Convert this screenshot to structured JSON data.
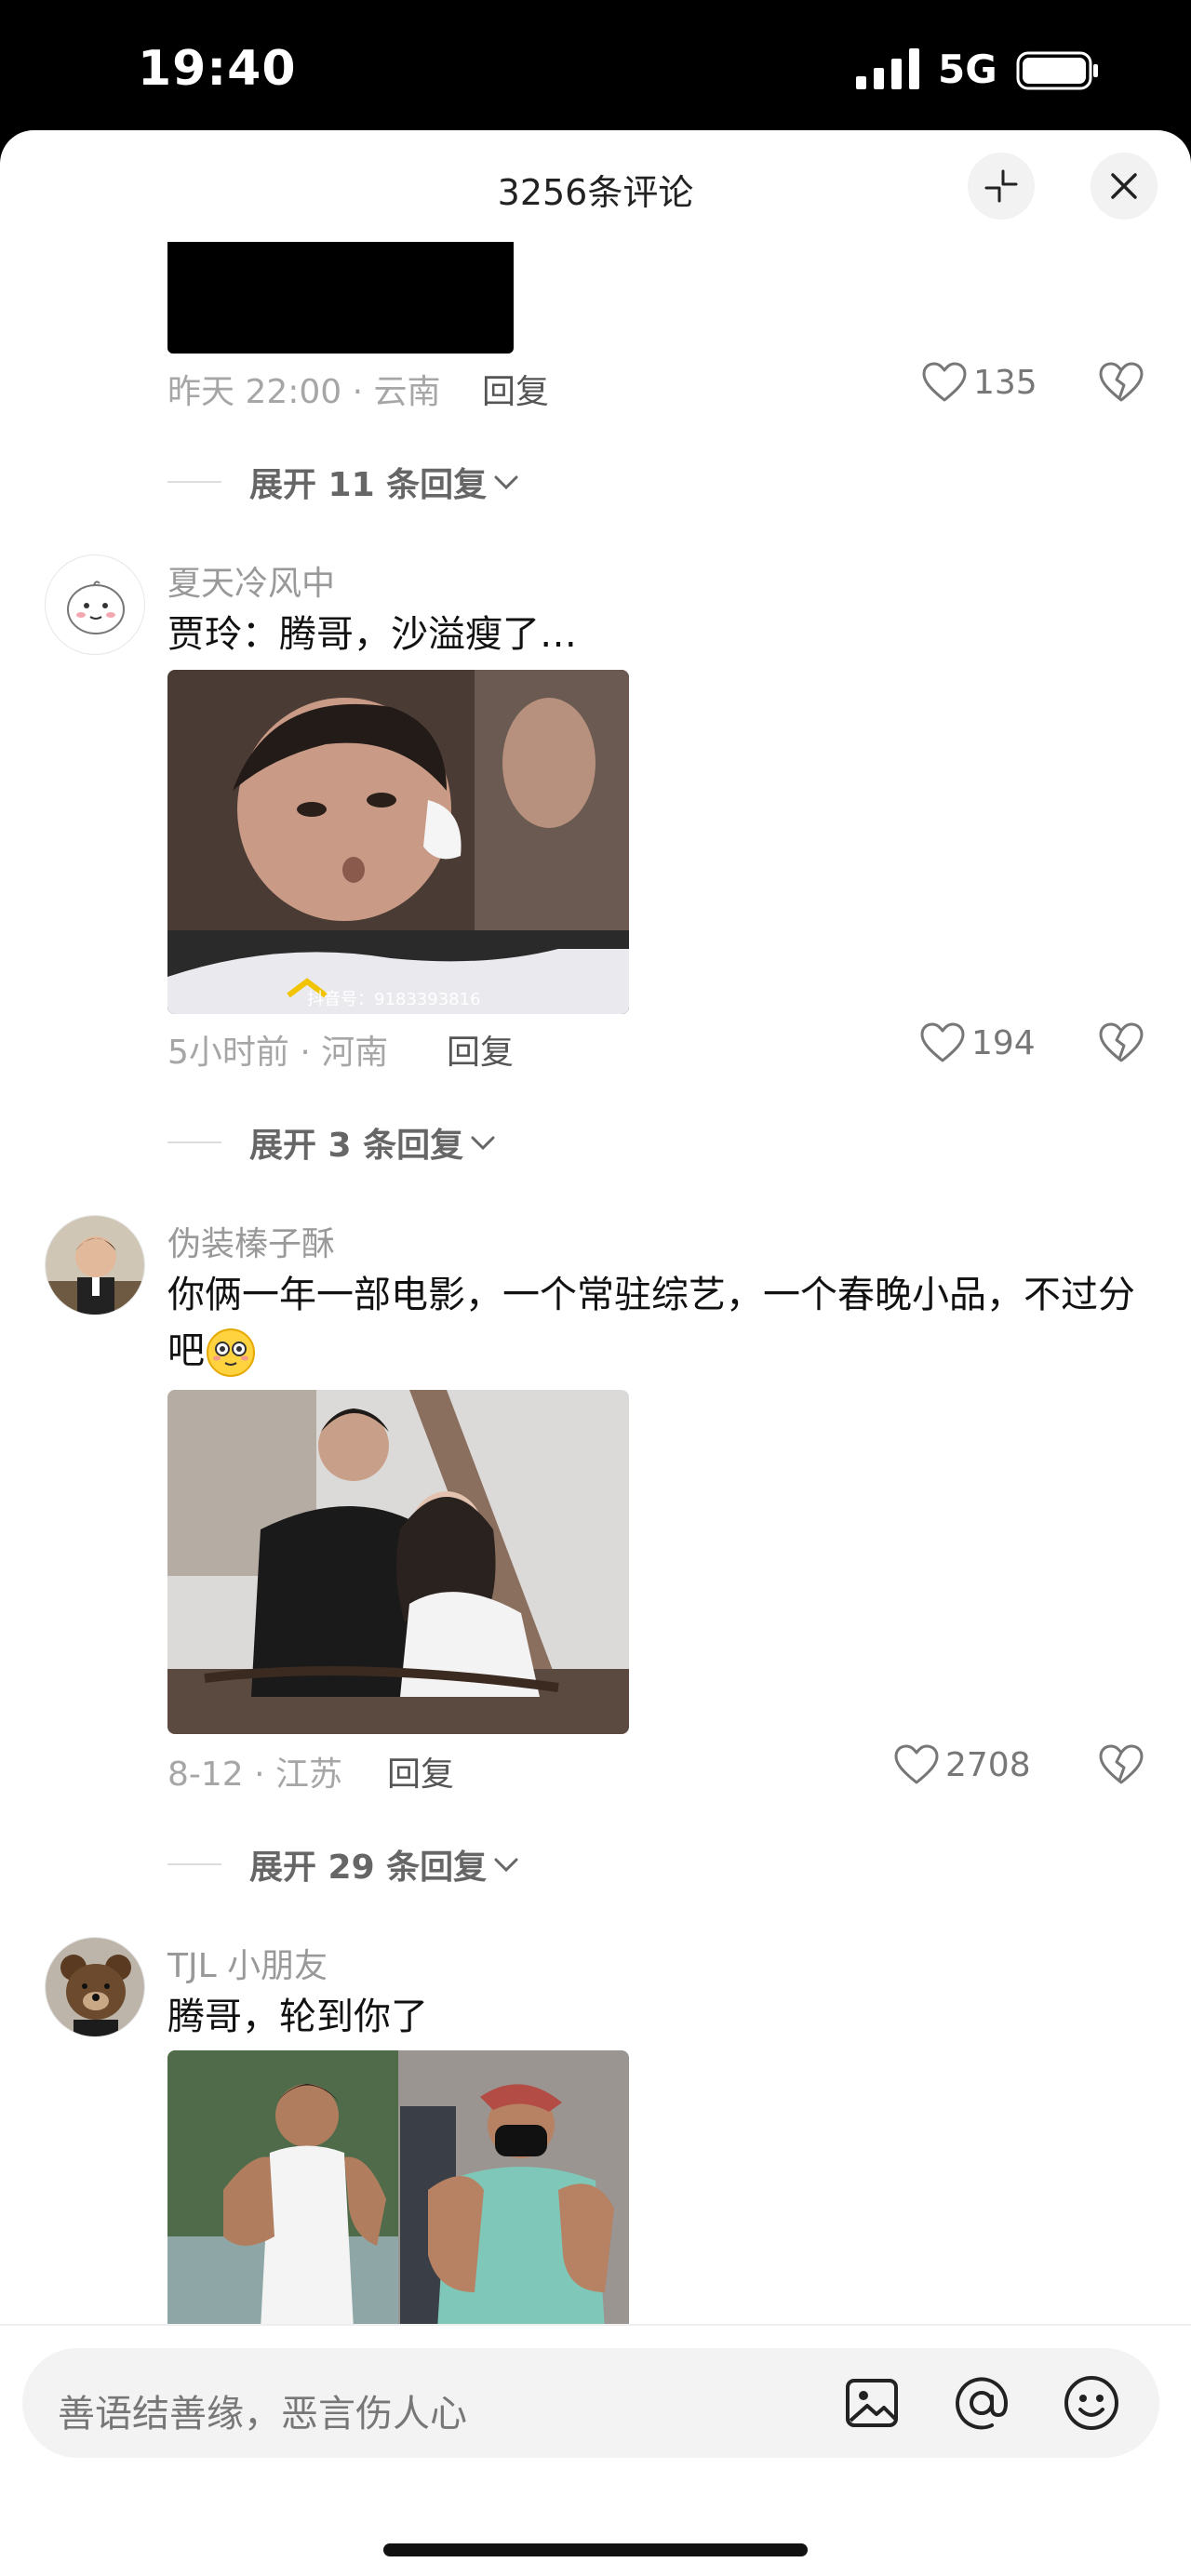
{
  "status_bar": {
    "time": "19:40",
    "network": "5G",
    "icons": [
      "signal-icon",
      "battery-icon"
    ]
  },
  "header": {
    "title": "3256条评论",
    "buttons": [
      "collapse-icon",
      "close-icon"
    ]
  },
  "comments": [
    {
      "meta": "昨天 22:00 · 云南",
      "reply_label": "回复",
      "likes": "135",
      "expand_label": "展开 11 条回复"
    },
    {
      "username": "夏天冷风中",
      "text": "贾玲：腾哥，沙溢瘦了…",
      "image_caption": "抖音号：9183393816",
      "meta": "5小时前 · 河南",
      "reply_label": "回复",
      "likes": "194",
      "expand_label": "展开 3 条回复"
    },
    {
      "username": "伪装榛子酥",
      "text": "你俩一年一部电影，一个常驻综艺，一个春晚小品，不过分吧",
      "emoji": "smile-emoji",
      "meta": "8-12 · 江苏",
      "reply_label": "回复",
      "likes": "2708",
      "expand_label": "展开 29 条回复"
    },
    {
      "username": "TJL 小朋友",
      "text": "腾哥，轮到你了"
    }
  ],
  "input": {
    "placeholder": "善语结善缘，恶言伤人心",
    "icons": [
      "image-icon",
      "at-icon",
      "emoji-icon"
    ]
  },
  "colors": {
    "background": "#ffffff",
    "muted_text": "#a6a6a6",
    "body_text": "#111111"
  }
}
